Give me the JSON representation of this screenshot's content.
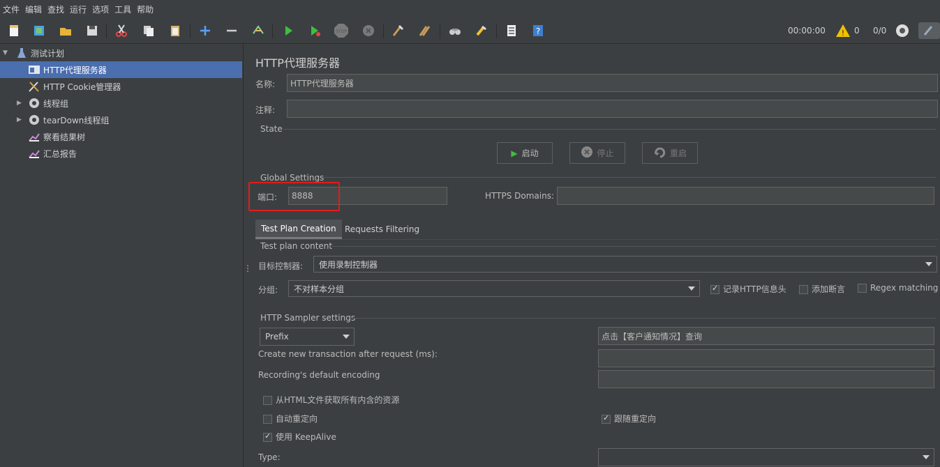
{
  "menu": [
    "文件",
    "编辑",
    "查找",
    "运行",
    "选项",
    "工具",
    "帮助"
  ],
  "toolbar": {
    "icons": [
      "new-file",
      "templates",
      "open",
      "save",
      "cut",
      "copy",
      "paste",
      "expand",
      "collapse",
      "toggle",
      "start",
      "start-no-pause",
      "stop",
      "shutdown",
      "clear",
      "clear-all",
      "search",
      "reset-search",
      "function-helper",
      "help"
    ],
    "timer": "00:00:00",
    "warnings": "0",
    "threads": "0/0"
  },
  "tree": {
    "items": [
      {
        "label": "测试计划",
        "icon": "test-plan-icon"
      },
      {
        "label": "HTTP代理服务器",
        "icon": "proxy-icon"
      },
      {
        "label": "HTTP Cookie管理器",
        "icon": "tools-icon"
      },
      {
        "label": "线程组",
        "icon": "gear-icon"
      },
      {
        "label": "tearDown线程组",
        "icon": "gear-icon"
      },
      {
        "label": "察看结果树",
        "icon": "chart-icon"
      },
      {
        "label": "汇总报告",
        "icon": "chart-icon"
      }
    ]
  },
  "panel": {
    "title": "HTTP代理服务器",
    "name_label": "名称:",
    "name_value": "HTTP代理服务器",
    "comment_label": "注释:",
    "comment_value": "",
    "state_title": "State",
    "start_label": "启动",
    "stop_label": "停止",
    "restart_label": "重启",
    "global_title": "Global Settings",
    "port_label": "端口:",
    "port_value": "8888",
    "https_label": "HTTPS Domains:",
    "https_value": "",
    "tabs": [
      "Test Plan Creation",
      "Requests Filtering"
    ],
    "content_title": "Test plan content",
    "target_label": "目标控制器:",
    "target_value": "使用录制控制器",
    "group_label": "分组:",
    "group_value": "不对样本分组",
    "record_headers": "记录HTTP信息头",
    "add_assert": "添加断言",
    "regex_matching": "Regex matching",
    "sampler_title": "HTTP Sampler settings",
    "prefix_value": "Prefix",
    "prefix_text": "点击【客户通知情况】查询",
    "create_tx_label": "Create new transaction after request (ms):",
    "create_tx_value": "",
    "encoding_label": "Recording's default encoding",
    "encoding_value": "",
    "fetch_resources": "从HTML文件获取所有内含的资源",
    "auto_redirect": "自动重定向",
    "follow_redirect": "跟随重定向",
    "keepalive": "使用 KeepAlive",
    "type_label": "Type:",
    "type_value": ""
  },
  "colors": {
    "accent": "#4b6eaf",
    "highlight": "#e31b1b",
    "bg": "#3c3f41"
  }
}
